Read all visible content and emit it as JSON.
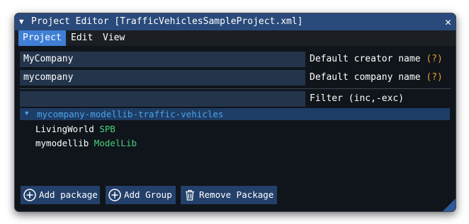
{
  "window": {
    "title": "Project Editor [TrafficVehiclesSampleProject.xml]",
    "close_glyph": "✕",
    "collapse_glyph": "▼"
  },
  "menu": {
    "items": [
      "Project",
      "Edit",
      "View"
    ],
    "active": "Project"
  },
  "fields": {
    "creator": {
      "value": "MyCompany",
      "label": "Default creator name",
      "help": "(?)"
    },
    "company": {
      "value": "mycompany",
      "label": "Default company name",
      "help": "(?)"
    },
    "filter": {
      "value": "",
      "label": "Filter (inc,-exc)"
    }
  },
  "tree": {
    "expand_glyph": "▼",
    "group": "mycompany-modellib-traffic-vehicles",
    "items": [
      {
        "name": "LivingWorld",
        "type": "SPB"
      },
      {
        "name": "mymodellib",
        "type": "ModelLib"
      }
    ]
  },
  "buttons": {
    "add_package": "Add package",
    "add_group": "Add Group",
    "remove_package": "Remove Package"
  },
  "colors": {
    "titlebar": "#294a7a",
    "menu_active": "#3f7fd6",
    "field_bg": "#23344b",
    "help": "#e8a030",
    "tree_header_text": "#4aa3e8",
    "type_text": "#48d17c",
    "button_bg": "#23406a"
  },
  "icons": {
    "add_package": "plus-circle-icon",
    "add_group": "plus-circle-icon",
    "remove_package": "trash-icon",
    "resize": "resize-grip-icon"
  }
}
